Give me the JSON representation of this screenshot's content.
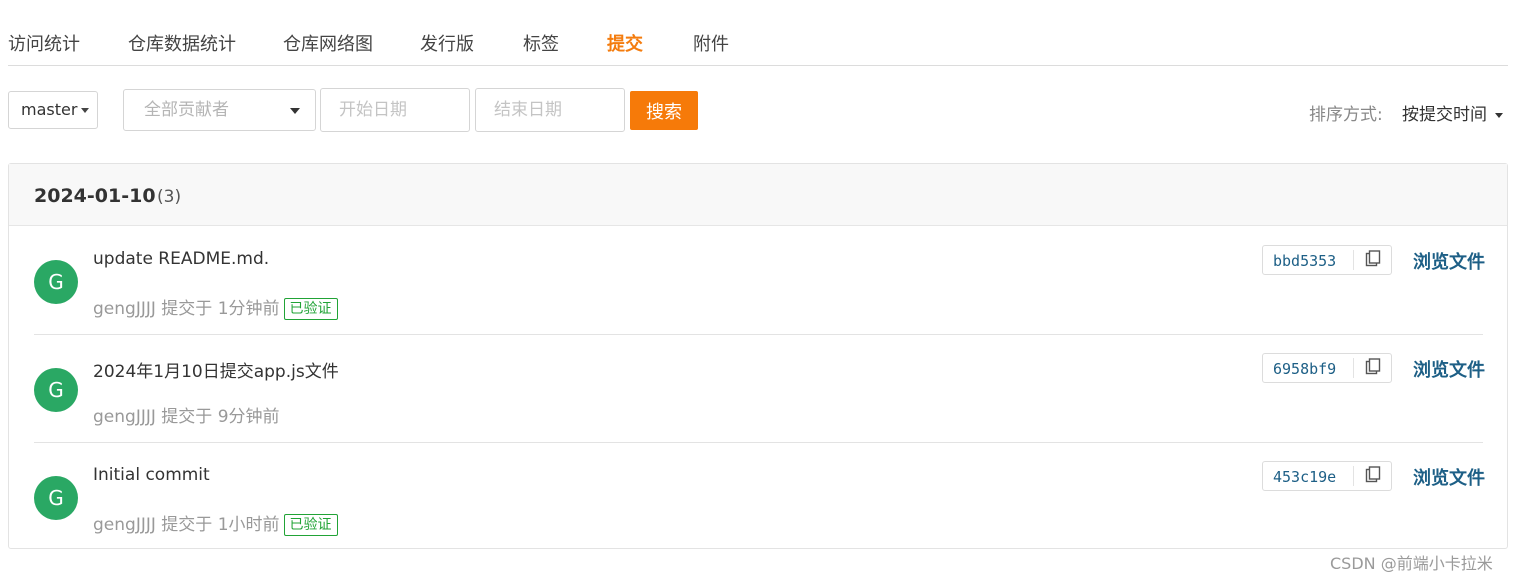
{
  "tabs": [
    {
      "label": "访问统计"
    },
    {
      "label": "仓库数据统计"
    },
    {
      "label": "仓库网络图"
    },
    {
      "label": "发行版"
    },
    {
      "label": "标签"
    },
    {
      "label": "提交",
      "active": true
    },
    {
      "label": "附件"
    }
  ],
  "filters": {
    "branch": "master",
    "contributor_placeholder": "全部贡献者",
    "start_date_placeholder": "开始日期",
    "end_date_placeholder": "结束日期",
    "search_label": "搜索",
    "sort_label": "排序方式:",
    "sort_value": "按提交时间"
  },
  "group": {
    "date": "2024-01-10",
    "count": "(3)"
  },
  "commits": [
    {
      "avatar": "G",
      "message": "update README.md.",
      "author": "gengJJJJ",
      "action": "提交于",
      "time": "1分钟前",
      "verified": "已验证",
      "sha": "bbd5353",
      "browse": "浏览文件"
    },
    {
      "avatar": "G",
      "message": "2024年1月10日提交app.js文件",
      "author": "gengJJJJ",
      "action": "提交于",
      "time": "9分钟前",
      "verified": null,
      "sha": "6958bf9",
      "browse": "浏览文件"
    },
    {
      "avatar": "G",
      "message": "Initial commit",
      "author": "gengJJJJ",
      "action": "提交于",
      "time": "1小时前",
      "verified": "已验证",
      "sha": "453c19e",
      "browse": "浏览文件"
    }
  ],
  "watermark": "CSDN @前端小卡拉米",
  "colors": {
    "accent": "#f47c0e",
    "avatar": "#2aa864",
    "verified": "#21a336",
    "link": "#1d5f86"
  },
  "icons": {
    "copy": "copy-icon",
    "caret": "caret-down-icon"
  }
}
